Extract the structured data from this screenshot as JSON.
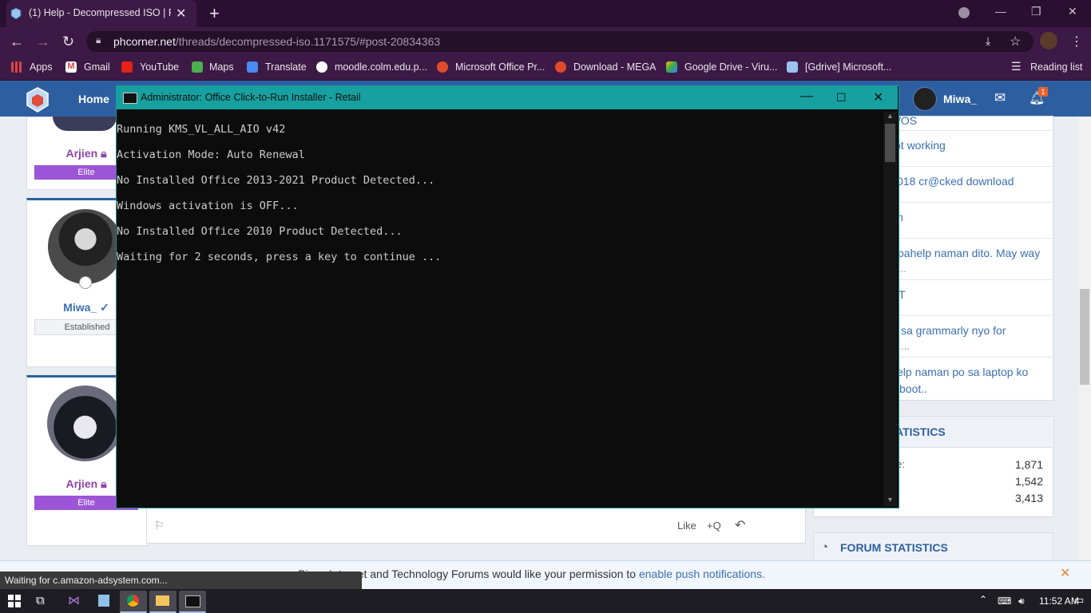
{
  "browser": {
    "tab_title": "(1) Help - Decompressed ISO | Pi",
    "url_domain": "phcorner.net",
    "url_path": "/threads/decompressed-iso.1171575/#post-20834363",
    "bookmarks": [
      "Apps",
      "Gmail",
      "YouTube",
      "Maps",
      "Translate",
      "moodle.colm.edu.p...",
      "Microsoft Office Pr...",
      "Download - MEGA",
      "Google Drive - Viru...",
      "[Gdrive] Microsoft..."
    ],
    "reading_list": "Reading list",
    "accent": "#3c1a45"
  },
  "site": {
    "home": "Home",
    "username": "Miwa_",
    "notification_count": "1"
  },
  "posts": [
    {
      "name": "Arjien",
      "rank": "Elite"
    },
    {
      "name": "Miwa_",
      "rank": "Established"
    },
    {
      "name": "Arjien",
      "rank": "Elite"
    }
  ],
  "post_actions": {
    "like": "Like",
    "quote": "+Q"
  },
  "sidebar": {
    "items": [
      {
        "text": "/OS",
        "sub": ""
      },
      {
        "text": "ot working",
        "sub": ""
      },
      {
        "text": "018 cr@cked download",
        "sub": ""
      },
      {
        "text": "n",
        "sub": ""
      },
      {
        "text": "pahelp naman dito. May way",
        "sub": "..."
      },
      {
        "text": "T",
        "sub": ""
      },
      {
        "text": "sa grammarly nyo for",
        "sub": "..."
      },
      {
        "text": "elp naman po sa laptop ko",
        "sub": "boot.."
      }
    ],
    "stats_title": "ATISTICS",
    "stats_rows": [
      {
        "label": "e:",
        "value": "1,871"
      },
      {
        "label": "",
        "value": "1,542"
      },
      {
        "label": "",
        "value": "3,413"
      }
    ],
    "forum_stats_title": "FORUM STATISTICS"
  },
  "push": {
    "text": "Pinoy Internet and Technology Forums would like your permission to ",
    "link": "enable push notifications."
  },
  "status_text": "Waiting for c.amazon-adsystem.com...",
  "console": {
    "title": "Administrator:  Office Click-to-Run Installer - Retail",
    "lines": [
      "Running KMS_VL_ALL_AIO v42",
      "Activation Mode: Auto Renewal",
      "No Installed Office 2013-2021 Product Detected...",
      "Windows activation is OFF...",
      "No Installed Office 2010 Product Detected...",
      "Waiting for 2 seconds, press a key to continue ..."
    ]
  },
  "taskbar": {
    "clock": "11:52 AM"
  }
}
